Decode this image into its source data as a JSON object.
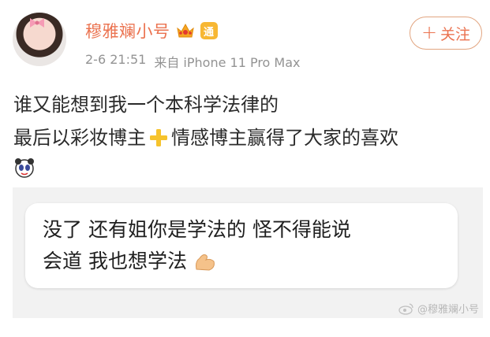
{
  "post": {
    "username": "穆雅斓小号",
    "vip_badge": "通",
    "date": "2-6 21:51",
    "source": "来自 iPhone 11 Pro Max",
    "follow_label": "关注",
    "follow_plus": "+",
    "line1": "谁又能想到我一个本科学法律的",
    "line2_part1": "最后以彩妆博主",
    "line2_part2": "情感博主赢得了大家的喜欢"
  },
  "screenshot": {
    "line1": "没了 还有姐你是学法的 怪不得能说",
    "line2": "会道 我也想学法"
  },
  "watermark": {
    "text": "@穆雅斓小号"
  },
  "colors": {
    "accent": "#eb7350",
    "text": "#2b2b2b",
    "meta": "#939393",
    "panel": "#f2f2f2",
    "vip": "#f7b733"
  },
  "icons": {
    "avatar": "avatar",
    "crown": "crown-icon",
    "cross": "yellow-cross-icon",
    "emoji": "panda-emoji-icon",
    "arm": "flexed-biceps-icon",
    "weibo": "weibo-logo-icon"
  }
}
